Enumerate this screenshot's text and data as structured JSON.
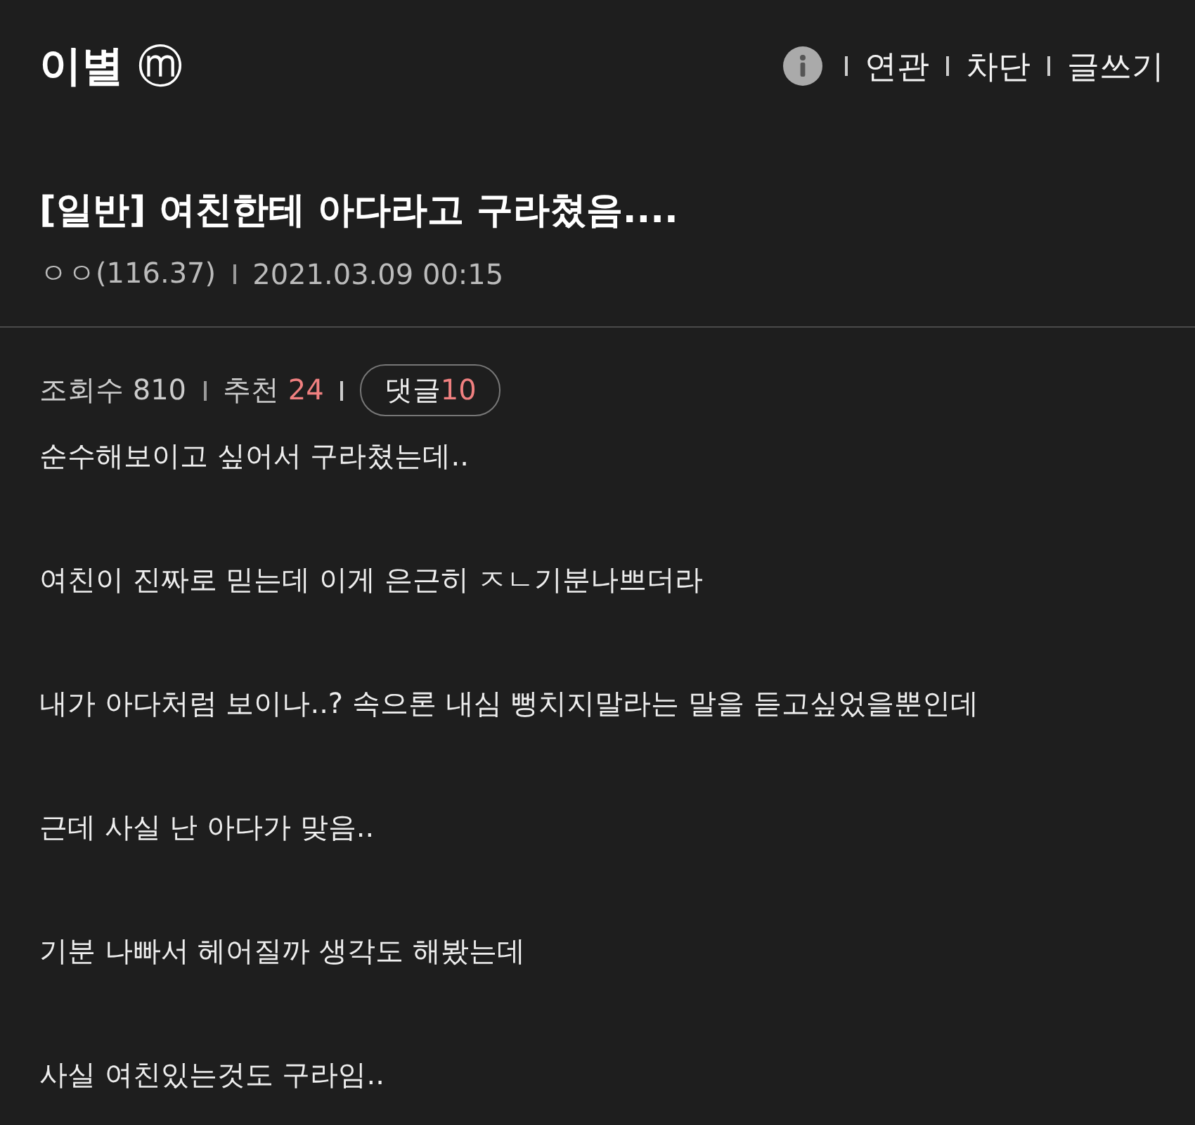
{
  "header": {
    "gallery_title": "이별",
    "badge": "ⓜ",
    "links": [
      "연관",
      "차단",
      "글쓰기"
    ]
  },
  "post": {
    "title": "[일반] 여친한테 아다라고 구라쳤음....",
    "author": "ㅇㅇ(116.37)",
    "date": "2021.03.09 00:15",
    "stats": {
      "views_label": "조회수",
      "views": "810",
      "recommend_label": "추천",
      "recommend": "24",
      "comments_label": "댓글",
      "comments": "10"
    },
    "paragraphs": [
      "순수해보이고 싶어서 구라쳤는데..",
      "여친이 진짜로 믿는데 이게 은근히 ㅈㄴ기분나쁘더라",
      "내가 아다처럼 보이나..? 속으론 내심 뻥치지말라는 말을 듣고싶었을뿐인데",
      "근데 사실 난 아다가 맞음..",
      "기분 나빠서 헤어질까 생각도 해봤는데",
      "사실 여친있는것도 구라임.."
    ]
  }
}
